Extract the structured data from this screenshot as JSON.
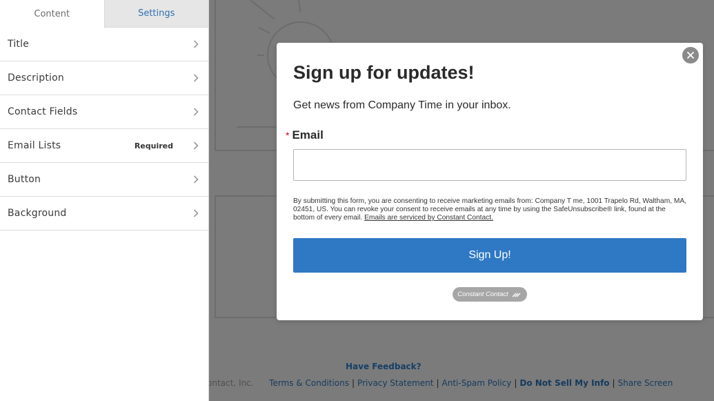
{
  "panel": {
    "tabs": [
      {
        "label": "Content",
        "active": true
      },
      {
        "label": "Settings",
        "active": false
      }
    ],
    "items": [
      {
        "label": "Title",
        "badge": ""
      },
      {
        "label": "Description",
        "badge": ""
      },
      {
        "label": "Contact Fields",
        "badge": ""
      },
      {
        "label": "Email Lists",
        "badge": "Required"
      },
      {
        "label": "Button",
        "badge": ""
      },
      {
        "label": "Background",
        "badge": ""
      }
    ]
  },
  "modal": {
    "title": "Sign up for updates!",
    "subtitle": "Get news from Company Time in your inbox.",
    "email_required_mark": "*",
    "email_label": "Email",
    "email_value": "",
    "consent_text": "By submitting this form, you are consenting to receive marketing emails from: Company T me, 1001 Trapelo Rd, Waltham, MA, 02451, US. You can revoke your consent to receive emails at any time by using the SafeUnsubscribe® link, found at the bottom of every email.",
    "consent_link": "Emails are serviced by Constant Contact.",
    "button_label": "Sign Up!",
    "badge_label": "Constant Contact"
  },
  "footer": {
    "feedback": "Have Feedback?",
    "copyright": "ontact, Inc.",
    "links": [
      "Terms & Conditions",
      "Privacy Statement",
      "Anti-Spam Policy",
      "Do Not Sell My Info",
      "Share Screen"
    ]
  },
  "icons": {
    "chevron": "chevron-right-icon",
    "close": "close-icon",
    "badge": "constant-contact-logo-icon"
  },
  "colors": {
    "accent": "#2f78c4",
    "tab_active_text": "#2f6fb0",
    "required": "#d0021b",
    "overlay": "#7b7b7b"
  }
}
